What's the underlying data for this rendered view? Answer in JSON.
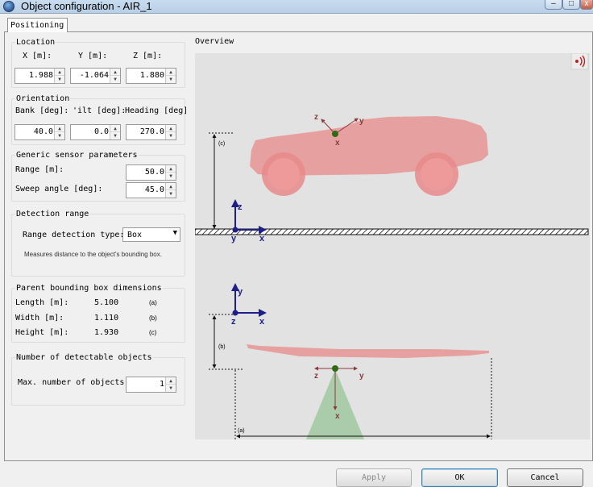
{
  "window": {
    "title": "Object configuration - AIR_1",
    "minimize_label": "–",
    "maximize_label": "□",
    "close_label": "x"
  },
  "tabs": [
    {
      "label": "Positioning",
      "active": true
    }
  ],
  "location": {
    "title": "Location",
    "x_label": "X  [m]:",
    "y_label": "Y  [m]:",
    "z_label": "Z  [m]:",
    "x_value": "1.988",
    "y_value": "-1.064",
    "z_value": "1.880"
  },
  "orientation": {
    "title": "Orientation",
    "bank_label": "Bank [deg]:",
    "tilt_label": "'ilt [deg]:",
    "heading_label": "Heading [deg]",
    "bank_value": "40.0",
    "tilt_value": "0.0",
    "heading_value": "270.0"
  },
  "generic_sensor": {
    "title": "Generic sensor parameters",
    "range_label": "Range  [m]:",
    "range_value": "50.0",
    "sweep_label": "Sweep angle [deg]:",
    "sweep_value": "45.0"
  },
  "detection_range": {
    "title": "Detection range",
    "type_label": "Range detection type:",
    "type_value": "Box",
    "note": "Measures distance to the object's bounding box."
  },
  "parent_bbox": {
    "title": "Parent bounding box dimensions",
    "rows": [
      {
        "label": "Length [m]:",
        "value": "5.100",
        "tag": "(a)"
      },
      {
        "label": "Width [m]:",
        "value": "1.110",
        "tag": "(b)"
      },
      {
        "label": "Height [m]:",
        "value": "1.930",
        "tag": "(c)"
      }
    ]
  },
  "detectable_objects": {
    "title": "Number of detectable objects",
    "max_label": "Max. number of objects",
    "max_value": "1"
  },
  "overview": {
    "title": "Overview",
    "sensor_icon": "radar-signal-icon",
    "dim_c": "(c)",
    "dim_b": "(b)",
    "dim_a": "(a)",
    "axis_x": "x",
    "axis_y": "y",
    "axis_z": "z"
  },
  "buttons": {
    "apply": "Apply",
    "ok": "OK",
    "cancel": "Cancel"
  },
  "colors": {
    "car": "#e88a8a",
    "axis_blue": "#1f1f8a",
    "sensor_axis": "#8a3a3a",
    "sensor_dot": "#2e6b12",
    "cone": "#9cc79c"
  }
}
